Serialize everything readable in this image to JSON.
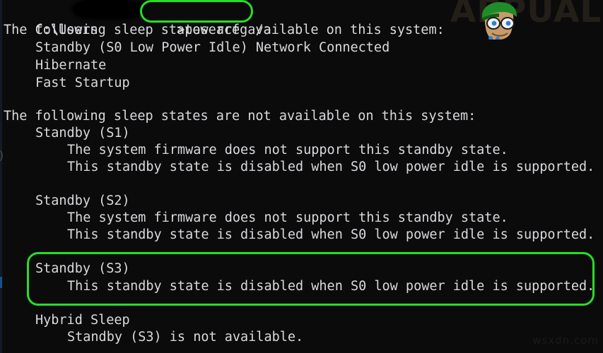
{
  "window": {
    "background_color": "#0b0b0b",
    "text_color": "#d8dade",
    "highlight_color": "#28dc28"
  },
  "prompt": {
    "path": "C:\\Users",
    "redacted_username": "",
    "separator": ">",
    "command": "powercfg /a"
  },
  "edge_artifact": ")",
  "console_lines": [
    {
      "indent": 0,
      "text": "The following sleep states are available on this system:"
    },
    {
      "indent": 1,
      "text": "Standby (S0 Low Power Idle) Network Connected"
    },
    {
      "indent": 1,
      "text": "Hibernate"
    },
    {
      "indent": 1,
      "text": "Fast Startup"
    },
    {
      "indent": 0,
      "text": "The following sleep states are not available on this system:"
    },
    {
      "indent": 1,
      "text": "Standby (S1)"
    },
    {
      "indent": 2,
      "text": "The system firmware does not support this standby state."
    },
    {
      "indent": 2,
      "text": "This standby state is disabled when S0 low power idle is supported."
    },
    {
      "indent": 1,
      "text": "Standby (S2)"
    },
    {
      "indent": 2,
      "text": "The system firmware does not support this standby state."
    },
    {
      "indent": 2,
      "text": "This standby state is disabled when S0 low power idle is supported."
    },
    {
      "indent": 1,
      "text": "Standby (S3)"
    },
    {
      "indent": 2,
      "text": "This standby state is disabled when S0 low power idle is supported."
    },
    {
      "indent": 1,
      "text": "Hybrid Sleep"
    },
    {
      "indent": 2,
      "text": "Standby (S3) is not available."
    }
  ],
  "highlights": [
    {
      "name": "command-highlight",
      "target": "powercfg /a"
    },
    {
      "name": "standby-s3-highlight",
      "target": "Standby (S3) block"
    }
  ],
  "watermark": {
    "brand": "APPUALS",
    "footer": "wsxdn.com"
  }
}
